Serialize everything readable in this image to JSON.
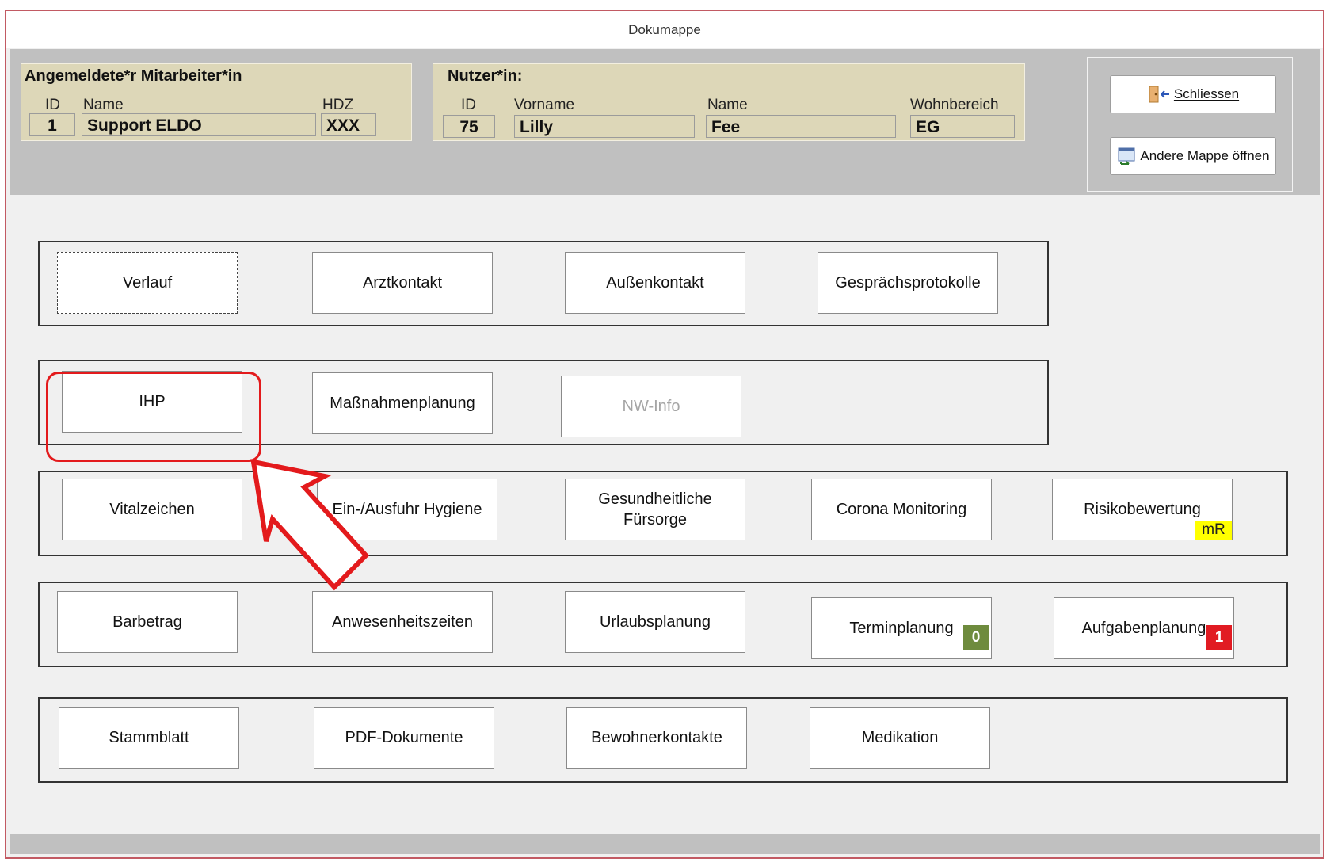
{
  "window": {
    "title": "Dokumappe"
  },
  "employee": {
    "title": "Angemeldete*r Mitarbeiter*in",
    "id_label": "ID",
    "name_label": "Name",
    "hdz_label": "HDZ",
    "id": "1",
    "name": "Support ELDO",
    "hdz": "XXX"
  },
  "user": {
    "title": "Nutzer*in:",
    "id_label": "ID",
    "firstname_label": "Vorname",
    "lastname_label": "Name",
    "area_label": "Wohnbereich",
    "id": "75",
    "firstname": "Lilly",
    "lastname": "Fee",
    "area": "EG"
  },
  "commands": {
    "close": "Schliessen",
    "open_other": "Andere Mappe öffnen"
  },
  "groups": {
    "g1": [
      "Verlauf",
      "Arztkontakt",
      "Außenkontakt",
      "Gesprächsprotokolle"
    ],
    "g2": [
      "IHP",
      "Maßnahmenplanung",
      "NW-Info"
    ],
    "g3": [
      "Vitalzeichen",
      "Ein-/Ausfuhr Hygiene",
      "Gesundheitliche",
      "Fürsorge",
      "Corona Monitoring",
      "Risikobewertung"
    ],
    "g4": [
      "Barbetrag",
      "Anwesenheitszeiten",
      "Urlaubsplanung",
      "Terminplanung",
      "Aufgabenplanung"
    ],
    "g5": [
      "Stammblatt",
      "PDF-Dokumente",
      "Bewohnerkontakte",
      "Medikation"
    ]
  },
  "badges": {
    "risk": "mR",
    "appointments": "0",
    "tasks": "1"
  },
  "colors": {
    "badge_yellow": "#ffff00",
    "badge_green": "#6e8b3d",
    "badge_red": "#e11b22",
    "highlight": "#e31a1c"
  }
}
